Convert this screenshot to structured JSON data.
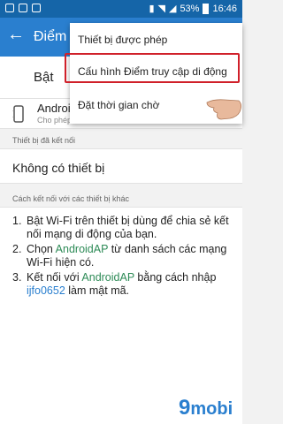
{
  "status_bar": {
    "battery": "53%",
    "time": "16:46"
  },
  "app_bar": {
    "back_icon": "arrow-left-icon",
    "title": "Điểm"
  },
  "toggle": {
    "label": "Bật"
  },
  "access_point": {
    "name": "Android",
    "subtitle": "Cho phép"
  },
  "connected_devices": {
    "header": "Thiết bị đã kết nối",
    "empty_text": "Không có thiết bị"
  },
  "instructions": {
    "header": "Cách kết nối với các thiết bị khác",
    "steps": [
      {
        "num": "1.",
        "text": "Bật Wi-Fi trên thiết bị dùng để chia sẻ kết nối mạng di động của bạn."
      },
      {
        "num": "2.",
        "pre": "Chọn ",
        "ap_name": "AndroidAP",
        "post": " từ danh sách các mạng Wi-Fi hiện có."
      },
      {
        "num": "3.",
        "pre": "Kết nối với ",
        "ap_name": "AndroidAP",
        "mid": " bằng cách nhập ",
        "password": "ijfo0652",
        "post": " làm mật mã."
      }
    ]
  },
  "menu": {
    "items": [
      {
        "label": "Thiết bị được phép"
      },
      {
        "label": "Cấu hình Điểm truy cập di động"
      },
      {
        "label": "Đặt thời gian chờ"
      }
    ],
    "highlighted_index": 1,
    "highlight_color": "#d0202a"
  },
  "watermark": {
    "nine": "9",
    "text": "mobi"
  },
  "colors": {
    "statusbar": "#1565a8",
    "appbar": "#2a7fcf",
    "link": "#2a7fcf",
    "green": "#2e8b57"
  }
}
